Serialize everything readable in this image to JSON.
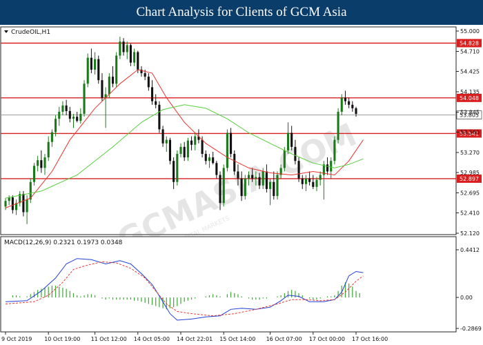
{
  "banner": {
    "title": "Chart Analysis for Clients of GCM Asia"
  },
  "watermark": {
    "text": "GCMASIA.COM",
    "subtext": "GLOBAL CAPITAL MARKETS"
  },
  "colors": {
    "banner": "#0b3d6b",
    "bull": "#1a7a1a",
    "bear": "#111111",
    "sma_fast": "#e8342b",
    "sma_slow": "#55d13a",
    "level": "#d81e1e",
    "macd_hist": "#3aa832",
    "macd_line": "#1f3fd6",
    "signal_line": "#e8342b"
  },
  "chart_data": [
    {
      "type": "candlestick",
      "title": "CrudeOIL,H1",
      "ylim": [
        52.12,
        55.0
      ],
      "y_ticks": [
        52.12,
        52.41,
        52.695,
        52.985,
        53.27,
        53.56,
        53.845,
        54.135,
        54.425,
        54.71,
        55.0
      ],
      "x_tick_labels": [
        "9 Oct 2019",
        "10 Oct 19:00",
        "11 Oct 12:00",
        "14 Oct 05:00",
        "14 Oct 22:01",
        "15 Oct 14:00",
        "16 Oct 07:00",
        "17 Oct 00:00",
        "17 Oct 16:00"
      ],
      "levels": [
        54.828,
        54.048,
        53.541,
        52.897
      ],
      "current_price": 53.805,
      "ohlc": [
        [
          52.5,
          52.62,
          52.45,
          52.58
        ],
        [
          52.58,
          52.66,
          52.52,
          52.63
        ],
        [
          52.63,
          52.66,
          52.4,
          52.45
        ],
        [
          52.45,
          52.6,
          52.38,
          52.55
        ],
        [
          52.55,
          52.72,
          52.5,
          52.68
        ],
        [
          52.68,
          52.72,
          52.36,
          52.42
        ],
        [
          52.42,
          52.66,
          52.25,
          52.6
        ],
        [
          52.6,
          52.9,
          52.55,
          52.85
        ],
        [
          52.85,
          53.12,
          52.8,
          53.08
        ],
        [
          53.08,
          53.22,
          53.0,
          53.16
        ],
        [
          53.16,
          53.3,
          52.98,
          53.05
        ],
        [
          53.05,
          53.25,
          52.95,
          53.2
        ],
        [
          53.2,
          53.5,
          53.15,
          53.42
        ],
        [
          53.42,
          53.6,
          53.35,
          53.56
        ],
        [
          53.56,
          53.8,
          53.5,
          53.75
        ],
        [
          53.75,
          53.92,
          53.65,
          53.85
        ],
        [
          53.85,
          54.0,
          53.8,
          53.94
        ],
        [
          53.94,
          54.02,
          53.8,
          53.86
        ],
        [
          53.86,
          53.92,
          53.7,
          53.75
        ],
        [
          53.75,
          53.82,
          53.62,
          53.78
        ],
        [
          53.78,
          53.85,
          53.7,
          53.72
        ],
        [
          53.72,
          53.9,
          53.68,
          53.82
        ],
        [
          53.82,
          54.3,
          53.78,
          54.25
        ],
        [
          54.25,
          54.68,
          54.2,
          54.62
        ],
        [
          54.62,
          54.75,
          54.4,
          54.45
        ],
        [
          54.45,
          54.7,
          54.38,
          54.6
        ],
        [
          54.6,
          54.65,
          54.25,
          54.3
        ],
        [
          54.3,
          54.4,
          54.0,
          54.05
        ],
        [
          54.05,
          54.2,
          53.62,
          54.1
        ],
        [
          54.1,
          54.4,
          54.05,
          54.35
        ],
        [
          54.35,
          54.5,
          54.2,
          54.25
        ],
        [
          54.25,
          54.7,
          54.2,
          54.65
        ],
        [
          54.65,
          54.92,
          54.6,
          54.85
        ],
        [
          54.85,
          54.9,
          54.65,
          54.7
        ],
        [
          54.7,
          54.85,
          54.6,
          54.8
        ],
        [
          54.8,
          54.82,
          54.5,
          54.55
        ],
        [
          54.55,
          54.75,
          54.5,
          54.7
        ],
        [
          54.7,
          54.72,
          54.4,
          54.45
        ],
        [
          54.45,
          54.5,
          54.35,
          54.4
        ],
        [
          54.4,
          54.45,
          54.3,
          54.35
        ],
        [
          54.35,
          54.4,
          54.15,
          54.2
        ],
        [
          54.2,
          54.3,
          53.95,
          54.0
        ],
        [
          54.0,
          54.1,
          53.9,
          53.95
        ],
        [
          53.95,
          54.0,
          53.55,
          53.6
        ],
        [
          53.6,
          53.65,
          53.35,
          53.4
        ],
        [
          53.4,
          53.5,
          53.28,
          53.45
        ],
        [
          53.45,
          53.48,
          53.1,
          53.15
        ],
        [
          53.15,
          53.2,
          52.75,
          52.85
        ],
        [
          52.85,
          53.3,
          52.8,
          53.25
        ],
        [
          53.25,
          53.4,
          53.2,
          53.35
        ],
        [
          53.35,
          53.42,
          53.15,
          53.2
        ],
        [
          53.2,
          53.48,
          53.15,
          53.44
        ],
        [
          53.44,
          53.5,
          53.3,
          53.38
        ],
        [
          53.38,
          53.55,
          53.3,
          53.5
        ],
        [
          53.5,
          53.6,
          53.4,
          53.45
        ],
        [
          53.45,
          53.5,
          53.2,
          53.25
        ],
        [
          53.25,
          53.3,
          53.1,
          53.15
        ],
        [
          53.15,
          53.25,
          53.05,
          53.2
        ],
        [
          53.2,
          53.28,
          53.1,
          53.12
        ],
        [
          53.12,
          53.15,
          52.9,
          52.95
        ],
        [
          52.95,
          53.0,
          52.45,
          52.55
        ],
        [
          52.55,
          53.1,
          52.5,
          53.05
        ],
        [
          53.05,
          53.6,
          53.0,
          53.55
        ],
        [
          53.55,
          53.62,
          53.2,
          53.25
        ],
        [
          53.25,
          53.3,
          52.95,
          53.0
        ],
        [
          53.0,
          53.1,
          52.8,
          52.9
        ],
        [
          52.9,
          53.0,
          52.58,
          52.65
        ],
        [
          52.65,
          52.95,
          52.6,
          52.9
        ],
        [
          52.9,
          53.0,
          52.8,
          52.95
        ],
        [
          52.95,
          53.05,
          52.85,
          52.9
        ],
        [
          52.9,
          53.0,
          52.8,
          52.92
        ],
        [
          52.92,
          52.98,
          52.75,
          52.8
        ],
        [
          52.8,
          53.05,
          52.75,
          53.0
        ],
        [
          53.0,
          53.1,
          52.7,
          52.75
        ],
        [
          52.75,
          52.9,
          52.52,
          52.85
        ],
        [
          52.85,
          53.0,
          52.6,
          52.65
        ],
        [
          52.65,
          53.0,
          52.6,
          52.95
        ],
        [
          52.95,
          53.1,
          52.9,
          53.05
        ],
        [
          53.05,
          53.35,
          53.0,
          53.3
        ],
        [
          53.3,
          53.7,
          53.25,
          53.55
        ],
        [
          53.55,
          53.65,
          53.3,
          53.35
        ],
        [
          53.35,
          53.45,
          53.1,
          53.15
        ],
        [
          53.15,
          53.2,
          52.85,
          52.9
        ],
        [
          52.9,
          52.95,
          52.75,
          52.82
        ],
        [
          52.82,
          52.95,
          52.72,
          52.9
        ],
        [
          52.9,
          53.0,
          52.8,
          52.85
        ],
        [
          52.85,
          52.95,
          52.75,
          52.78
        ],
        [
          52.78,
          52.92,
          52.72,
          52.88
        ],
        [
          52.88,
          53.0,
          52.8,
          52.95
        ],
        [
          52.95,
          53.15,
          52.6,
          53.1
        ],
        [
          53.1,
          53.2,
          52.95,
          53.0
        ],
        [
          53.0,
          53.2,
          52.9,
          53.15
        ],
        [
          53.15,
          53.5,
          53.1,
          53.45
        ],
        [
          53.45,
          53.9,
          53.4,
          53.85
        ],
        [
          53.85,
          54.1,
          53.8,
          54.05
        ],
        [
          54.05,
          54.15,
          53.95,
          54.0
        ],
        [
          54.0,
          54.05,
          53.9,
          53.95
        ],
        [
          53.95,
          54.0,
          53.85,
          53.9
        ],
        [
          53.9,
          53.92,
          53.78,
          53.82
        ]
      ],
      "sma_fast": [
        [
          0,
          52.48
        ],
        [
          7,
          52.62
        ],
        [
          13,
          53.0
        ],
        [
          18,
          53.45
        ],
        [
          25,
          53.9
        ],
        [
          32,
          54.25
        ],
        [
          37,
          54.45
        ],
        [
          41,
          54.4
        ],
        [
          45,
          54.05
        ],
        [
          50,
          53.7
        ],
        [
          56,
          53.4
        ],
        [
          62,
          53.2
        ],
        [
          68,
          53.05
        ],
        [
          74,
          52.98
        ],
        [
          80,
          52.95
        ],
        [
          86,
          53.0
        ],
        [
          92,
          52.95
        ],
        [
          96,
          53.15
        ],
        [
          100,
          53.45
        ]
      ],
      "sma_slow": [
        [
          0,
          52.62
        ],
        [
          10,
          52.72
        ],
        [
          20,
          52.95
        ],
        [
          30,
          53.35
        ],
        [
          38,
          53.7
        ],
        [
          44,
          53.88
        ],
        [
          50,
          53.95
        ],
        [
          56,
          53.9
        ],
        [
          62,
          53.75
        ],
        [
          68,
          53.55
        ],
        [
          74,
          53.4
        ],
        [
          80,
          53.25
        ],
        [
          86,
          53.12
        ],
        [
          92,
          53.05
        ],
        [
          96,
          53.1
        ],
        [
          100,
          53.18
        ]
      ]
    },
    {
      "type": "macd",
      "label": "MACD(12,26,9) 0.2321 0.1973 0.0348",
      "ylim": [
        -0.2869,
        0.4412
      ],
      "y_ticks": [
        0.4412,
        0.0,
        -0.2869
      ],
      "histogram": [
        0.0,
        0.0,
        0.02,
        0.02,
        0.01,
        0.0,
        0.01,
        0.03,
        0.05,
        0.07,
        0.08,
        0.09,
        0.1,
        0.11,
        0.11,
        0.1,
        0.09,
        0.08,
        0.06,
        0.04,
        0.02,
        0.01,
        0.02,
        0.03,
        0.03,
        0.02,
        0.0,
        -0.01,
        -0.02,
        -0.01,
        -0.02,
        -0.02,
        -0.02,
        -0.02,
        -0.02,
        -0.02,
        -0.03,
        -0.03,
        -0.04,
        -0.05,
        -0.06,
        -0.07,
        -0.08,
        -0.09,
        -0.1,
        -0.11,
        -0.1,
        -0.09,
        -0.08,
        -0.06,
        -0.04,
        -0.03,
        -0.02,
        -0.01,
        0.0,
        0.0,
        0.01,
        0.02,
        0.03,
        0.02,
        0.01,
        0.0,
        0.03,
        0.05,
        0.04,
        0.03,
        0.01,
        0.0,
        -0.01,
        -0.02,
        -0.02,
        -0.02,
        -0.01,
        -0.01,
        0.0,
        0.0,
        0.01,
        0.02,
        0.04,
        0.06,
        0.07,
        0.06,
        0.04,
        0.02,
        0.0,
        -0.01,
        -0.02,
        -0.02,
        -0.01,
        0.0,
        0.01,
        0.01,
        0.02,
        0.06,
        0.11,
        0.14,
        0.13,
        0.1,
        0.06,
        0.04
      ],
      "macd_line": [
        [
          0,
          -0.04
        ],
        [
          6,
          -0.03
        ],
        [
          10,
          0.06
        ],
        [
          14,
          0.18
        ],
        [
          17,
          0.31
        ],
        [
          20,
          0.36
        ],
        [
          24,
          0.35
        ],
        [
          28,
          0.31
        ],
        [
          32,
          0.34
        ],
        [
          35,
          0.31
        ],
        [
          38,
          0.22
        ],
        [
          41,
          0.12
        ],
        [
          44,
          -0.04
        ],
        [
          46,
          -0.15
        ],
        [
          48,
          -0.21
        ],
        [
          52,
          -0.2
        ],
        [
          56,
          -0.18
        ],
        [
          60,
          -0.17
        ],
        [
          63,
          -0.11
        ],
        [
          66,
          -0.1
        ],
        [
          70,
          -0.11
        ],
        [
          74,
          -0.09
        ],
        [
          77,
          -0.03
        ],
        [
          79,
          0.02
        ],
        [
          82,
          0.01
        ],
        [
          85,
          -0.04
        ],
        [
          89,
          -0.04
        ],
        [
          92,
          -0.02
        ],
        [
          94,
          0.05
        ],
        [
          96,
          0.2
        ],
        [
          98,
          0.24
        ],
        [
          100,
          0.23
        ]
      ],
      "signal_line": [
        [
          0,
          -0.06
        ],
        [
          8,
          -0.04
        ],
        [
          12,
          0.02
        ],
        [
          16,
          0.14
        ],
        [
          19,
          0.26
        ],
        [
          23,
          0.3
        ],
        [
          27,
          0.33
        ],
        [
          31,
          0.32
        ],
        [
          35,
          0.27
        ],
        [
          39,
          0.18
        ],
        [
          42,
          0.06
        ],
        [
          45,
          -0.06
        ],
        [
          48,
          -0.13
        ],
        [
          52,
          -0.15
        ],
        [
          58,
          -0.17
        ],
        [
          64,
          -0.15
        ],
        [
          70,
          -0.11
        ],
        [
          76,
          -0.06
        ],
        [
          80,
          -0.02
        ],
        [
          84,
          -0.02
        ],
        [
          88,
          -0.03
        ],
        [
          92,
          -0.02
        ],
        [
          95,
          0.05
        ],
        [
          98,
          0.15
        ],
        [
          100,
          0.2
        ]
      ]
    }
  ]
}
